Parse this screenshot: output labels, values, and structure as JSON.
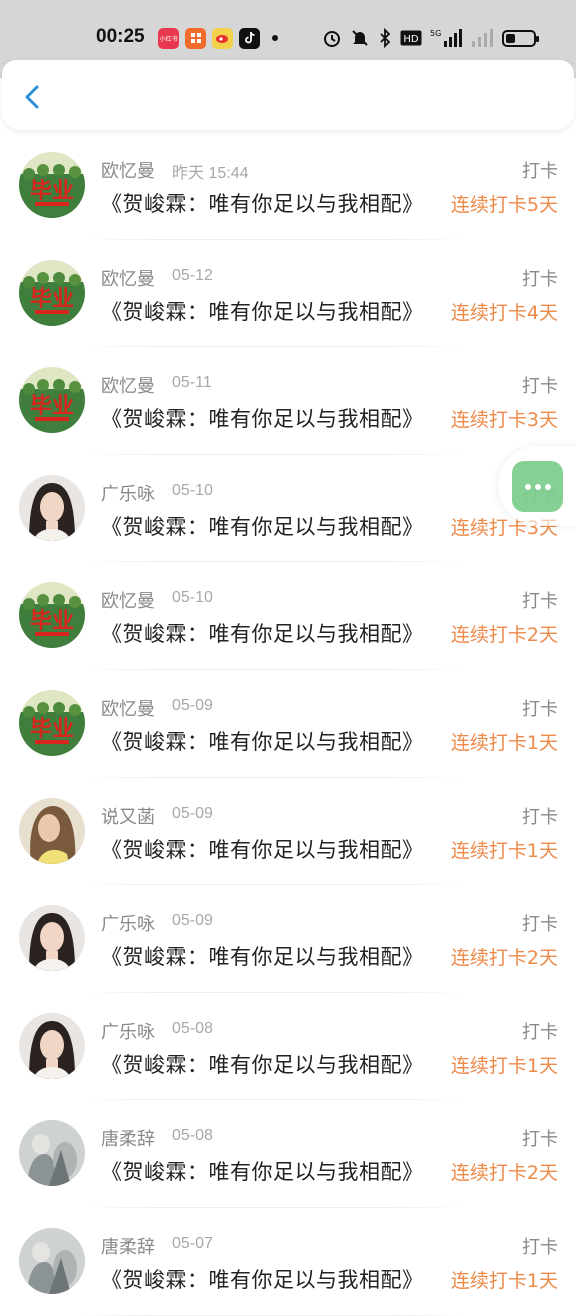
{
  "status_bar": {
    "time": "00:25",
    "app_icons": [
      {
        "name": "news-app-icon",
        "label": "小红书",
        "color": "#e8384f"
      },
      {
        "name": "shop-app-icon",
        "label": "",
        "color": "#f36b2b"
      },
      {
        "name": "weibo-icon",
        "label": "",
        "color": "#f5d24b"
      },
      {
        "name": "tiktok-icon",
        "label": "",
        "color": "#111111"
      }
    ],
    "battery_level": 0.35
  },
  "nav": {
    "back_label": "back"
  },
  "items": [
    {
      "name": "欧忆曼",
      "time": "昨天 15:44",
      "title": "《贺峻霖：唯有你足以与我相配》",
      "action": "打卡",
      "streak": "连续打卡5天",
      "avatar": "team"
    },
    {
      "name": "欧忆曼",
      "time": "05-12",
      "title": "《贺峻霖：唯有你足以与我相配》",
      "action": "打卡",
      "streak": "连续打卡4天",
      "avatar": "team"
    },
    {
      "name": "欧忆曼",
      "time": "05-11",
      "title": "《贺峻霖：唯有你足以与我相配》",
      "action": "打卡",
      "streak": "连续打卡3天",
      "avatar": "team"
    },
    {
      "name": "广乐咏",
      "time": "05-10",
      "title": "《贺峻霖：唯有你足以与我相配》",
      "action": "打卡",
      "streak": "连续打卡3天",
      "avatar": "girl"
    },
    {
      "name": "欧忆曼",
      "time": "05-10",
      "title": "《贺峻霖：唯有你足以与我相配》",
      "action": "打卡",
      "streak": "连续打卡2天",
      "avatar": "team"
    },
    {
      "name": "欧忆曼",
      "time": "05-09",
      "title": "《贺峻霖：唯有你足以与我相配》",
      "action": "打卡",
      "streak": "连续打卡1天",
      "avatar": "team"
    },
    {
      "name": "说又菡",
      "time": "05-09",
      "title": "《贺峻霖：唯有你足以与我相配》",
      "action": "打卡",
      "streak": "连续打卡1天",
      "avatar": "blonde"
    },
    {
      "name": "广乐咏",
      "time": "05-09",
      "title": "《贺峻霖：唯有你足以与我相配》",
      "action": "打卡",
      "streak": "连续打卡2天",
      "avatar": "girl"
    },
    {
      "name": "广乐咏",
      "time": "05-08",
      "title": "《贺峻霖：唯有你足以与我相配》",
      "action": "打卡",
      "streak": "连续打卡1天",
      "avatar": "girl"
    },
    {
      "name": "唐柔辞",
      "time": "05-08",
      "title": "《贺峻霖：唯有你足以与我相配》",
      "action": "打卡",
      "streak": "连续打卡2天",
      "avatar": "gray"
    },
    {
      "name": "唐柔辞",
      "time": "05-07",
      "title": "《贺峻霖：唯有你足以与我相配》",
      "action": "打卡",
      "streak": "连续打卡1天",
      "avatar": "gray"
    }
  ],
  "colors": {
    "accent_orange": "#ee8a4a",
    "back_blue": "#2b8fd9",
    "float_green": "#6ec882"
  }
}
